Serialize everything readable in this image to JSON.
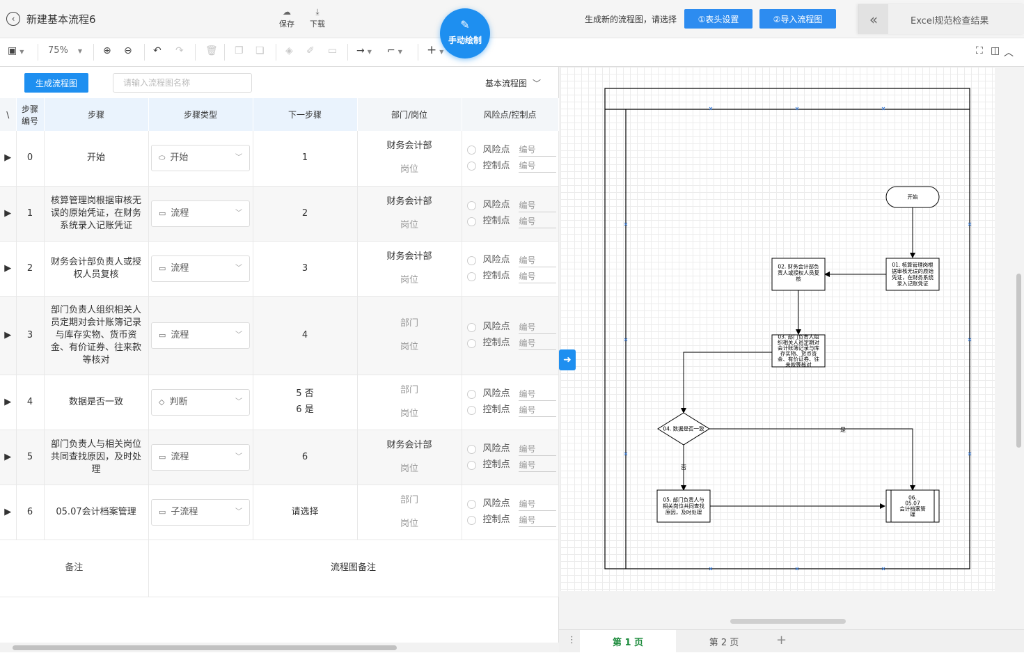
{
  "header": {
    "title": "新建基本流程6",
    "save": "保存",
    "download": "下载",
    "manual_draw": "手动绘制",
    "hint": "生成新的流程图，请选择",
    "header_settings": "①表头设置",
    "import_flow": "②导入流程图",
    "excel_panel_title": "Excel规范检查结果"
  },
  "toolbar": {
    "zoom": "75%"
  },
  "form": {
    "generate_button": "生成流程图",
    "name_placeholder": "请输入流程图名称",
    "flow_type": "基本流程图"
  },
  "table": {
    "headers": {
      "corner": "\\",
      "step_no_line1": "步骤",
      "step_no_line2": "编号",
      "step": "步骤",
      "step_type": "步骤类型",
      "next_step": "下一步骤",
      "dept": "部门/岗位",
      "risk": "风险点/控制点"
    },
    "risk_label": "风险点",
    "control_label": "控制点",
    "number_placeholder": "编号",
    "post_placeholder": "岗位",
    "rows": [
      {
        "no": "0",
        "text": "开始",
        "type": "开始",
        "next1": "1",
        "next2": "",
        "dept": "财务会计部",
        "dept_is_placeholder": false
      },
      {
        "no": "1",
        "text": "核算管理岗根据审核无误的原始凭证，在财务系统录入记账凭证",
        "type": "流程",
        "next1": "2",
        "next2": "",
        "dept": "财务会计部",
        "dept_is_placeholder": false
      },
      {
        "no": "2",
        "text": "财务会计部负责人或授权人员复核",
        "type": "流程",
        "next1": "3",
        "next2": "",
        "dept": "财务会计部",
        "dept_is_placeholder": false
      },
      {
        "no": "3",
        "text": "部门负责人组织相关人员定期对会计账簿记录与库存实物、货币资金、有价证券、往来款等核对",
        "type": "流程",
        "next1": "4",
        "next2": "",
        "dept": "部门",
        "dept_is_placeholder": true
      },
      {
        "no": "4",
        "text": "数据是否一致",
        "type": "判断",
        "next1": "5 否",
        "next2": "6 是",
        "dept": "部门",
        "dept_is_placeholder": true
      },
      {
        "no": "5",
        "text": "部门负责人与相关岗位共同查找原因，及时处理",
        "type": "流程",
        "next1": "6",
        "next2": "",
        "dept": "财务会计部",
        "dept_is_placeholder": false
      },
      {
        "no": "6",
        "text": "05.07会计档案管理",
        "type": "子流程",
        "next1": "请选择",
        "next2": "",
        "dept": "部门",
        "dept_is_placeholder": true
      }
    ],
    "remark_label": "备注",
    "remark_placeholder": "流程图备注"
  },
  "diagram": {
    "start": "开始",
    "n01": [
      "01. 核算管理岗根",
      "据审核无误的原始",
      "凭证，在财务系统",
      "录入记账凭证"
    ],
    "n02": [
      "02. 财务会计部负",
      "责人或授权人员复",
      "核"
    ],
    "n03": [
      "03. 部门负责人组",
      "织相关人员定期对",
      "会计账簿记录与库",
      "存实物、货币资",
      "金、有价证券、往",
      "来款等核对"
    ],
    "n04": "04. 数据是否一致",
    "n05": [
      "05. 部门负责人与",
      "相关岗位共同查找",
      "原因，及时处理"
    ],
    "n06": [
      "06.",
      "05.07",
      "会计档案管",
      "理"
    ],
    "yes": "是",
    "no": "否"
  },
  "pages": {
    "page1": "第 1 页",
    "page2": "第 2 页"
  }
}
